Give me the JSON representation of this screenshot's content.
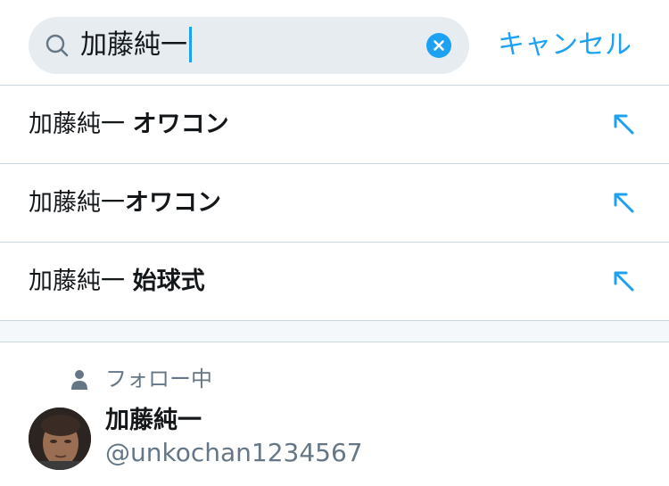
{
  "search": {
    "query": "加藤純一",
    "cancel_label": "キャンセル",
    "icon": "search-icon",
    "clear_icon": "clear-icon"
  },
  "suggestions": [
    {
      "prefix": "加藤純一 ",
      "bold": "オワコン",
      "icon": "fill-query-arrow-icon"
    },
    {
      "prefix": "加藤純一",
      "bold": "オワコン",
      "icon": "fill-query-arrow-icon"
    },
    {
      "prefix": "加藤純一 ",
      "bold": "始球式",
      "icon": "fill-query-arrow-icon"
    }
  ],
  "people": {
    "section_label": "フォロー中",
    "section_icon": "person-icon",
    "user": {
      "name": "加藤純一",
      "handle": "@unkochan1234567"
    }
  },
  "colors": {
    "accent": "#1da1f2",
    "search_bg": "#e6ecf0",
    "secondary_text": "#657786",
    "divider": "#ccd6dd"
  }
}
